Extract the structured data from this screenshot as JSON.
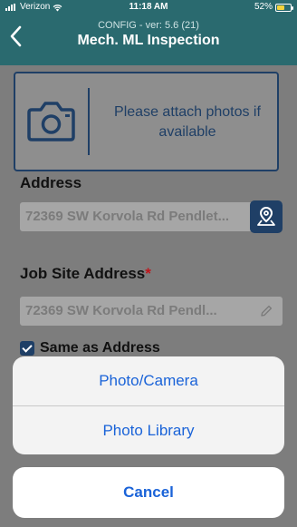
{
  "status_bar": {
    "carrier": "Verizon",
    "time": "11:18 AM",
    "battery": "52%"
  },
  "nav": {
    "subtitle": "CONFIG - ver: 5.6 (21)",
    "title": "Mech. ML Inspection",
    "back_icon": "chevron-left-icon"
  },
  "photo_prompt": {
    "text": "Please attach photos if available",
    "icon": "camera-icon"
  },
  "form": {
    "address_label": "Address",
    "address_value": "72369 SW Korvola Rd Pendlet...",
    "job_site_label": "Job Site Address",
    "required_mark": "*",
    "job_site_value": "72369 SW Korvola Rd Pendl...",
    "same_as_address_label": "Same as Address",
    "same_as_address_checked": true
  },
  "action_sheet": {
    "options": [
      "Photo/Camera",
      "Photo Library"
    ],
    "cancel_label": "Cancel"
  },
  "colors": {
    "nav_bg": "#2a6a6f",
    "accent_navy": "#1f3f66",
    "action_blue": "#1a63d8",
    "required_red": "#c0151b"
  }
}
